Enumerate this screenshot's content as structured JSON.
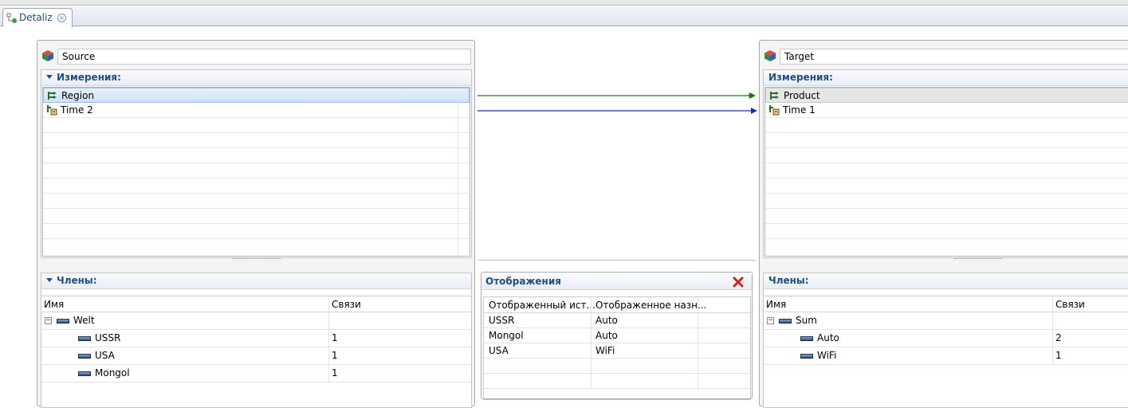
{
  "editor_tab": {
    "label": "Detaliz"
  },
  "source": {
    "name": "Source",
    "dimensions_header": "Измерения:",
    "dimensions": [
      {
        "label": "Region",
        "icon": "hierarchy-icon",
        "selected": true
      },
      {
        "label": "Time 2",
        "icon": "time-hierarchy-icon",
        "selected": false
      }
    ],
    "members_header": "Члены:",
    "columns": [
      "Имя",
      "Связи"
    ],
    "members": [
      {
        "name": "Welt",
        "links": "",
        "level": 0,
        "expanded": true
      },
      {
        "name": "USSR",
        "links": "1",
        "level": 1
      },
      {
        "name": "USA",
        "links": "1",
        "level": 1
      },
      {
        "name": "Mongol",
        "links": "1",
        "level": 1
      }
    ]
  },
  "target": {
    "name": "Target",
    "dimensions_header": "Измерения:",
    "dimensions": [
      {
        "label": "Product",
        "icon": "hierarchy-icon",
        "selected": true
      },
      {
        "label": "Time 1",
        "icon": "time-hierarchy-icon",
        "selected": false
      }
    ],
    "members_header": "Члены:",
    "columns": [
      "Имя",
      "Связи"
    ],
    "members": [
      {
        "name": "Sum",
        "links": "",
        "level": 0,
        "expanded": true
      },
      {
        "name": "Auto",
        "links": "2",
        "level": 1
      },
      {
        "name": "WiFi",
        "links": "1",
        "level": 1
      }
    ]
  },
  "mappings": {
    "header": "Отображения",
    "columns": [
      "Отображенный ист...",
      "Отображенное назн..."
    ],
    "rows": [
      {
        "source": "USSR",
        "target": "Auto"
      },
      {
        "source": "Mongol",
        "target": "Auto"
      },
      {
        "source": "USA",
        "target": "WiFi"
      }
    ]
  },
  "links": [
    {
      "from": "Region",
      "to": "Product",
      "color": "#1e7a1e"
    },
    {
      "from": "Time 2",
      "to": "Time 1",
      "color": "#1f2fa8"
    }
  ]
}
